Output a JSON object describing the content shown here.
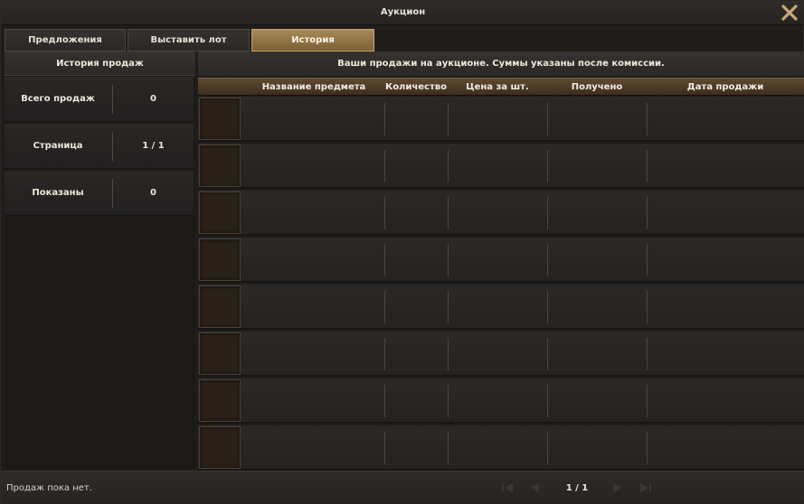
{
  "window": {
    "title": "Аукцион"
  },
  "tabs": [
    {
      "label": "Предложения",
      "active": false
    },
    {
      "label": "Выставить лот",
      "active": false
    },
    {
      "label": "История",
      "active": true
    }
  ],
  "left_panel": {
    "title": "История продаж",
    "stats": [
      {
        "label": "Всего продаж",
        "value": "0"
      },
      {
        "label": "Страница",
        "value": "1 / 1"
      },
      {
        "label": "Показаны",
        "value": "0"
      }
    ]
  },
  "right_panel": {
    "info": "Ваши продажи на аукционе. Суммы указаны после комиссии.",
    "columns": [
      "Название предмета",
      "Количество",
      "Цена за шт.",
      "Получено",
      "Дата продажи"
    ],
    "rows": [
      {
        "item": "",
        "quantity": "",
        "unit_price": "",
        "received": "",
        "date": ""
      },
      {
        "item": "",
        "quantity": "",
        "unit_price": "",
        "received": "",
        "date": ""
      },
      {
        "item": "",
        "quantity": "",
        "unit_price": "",
        "received": "",
        "date": ""
      },
      {
        "item": "",
        "quantity": "",
        "unit_price": "",
        "received": "",
        "date": ""
      },
      {
        "item": "",
        "quantity": "",
        "unit_price": "",
        "received": "",
        "date": ""
      },
      {
        "item": "",
        "quantity": "",
        "unit_price": "",
        "received": "",
        "date": ""
      },
      {
        "item": "",
        "quantity": "",
        "unit_price": "",
        "received": "",
        "date": ""
      },
      {
        "item": "",
        "quantity": "",
        "unit_price": "",
        "received": "",
        "date": ""
      }
    ]
  },
  "footer": {
    "status": "Продаж пока нет.",
    "page": "1 / 1"
  },
  "icons": {
    "close": "close-icon",
    "first_page": "first-page-icon",
    "prev_page": "prev-page-icon",
    "next_page": "next-page-icon",
    "last_page": "last-page-icon"
  },
  "colors": {
    "accent": "#a98a5a",
    "close_icon": "#c9a77a",
    "column_header": "#5e4a31"
  }
}
